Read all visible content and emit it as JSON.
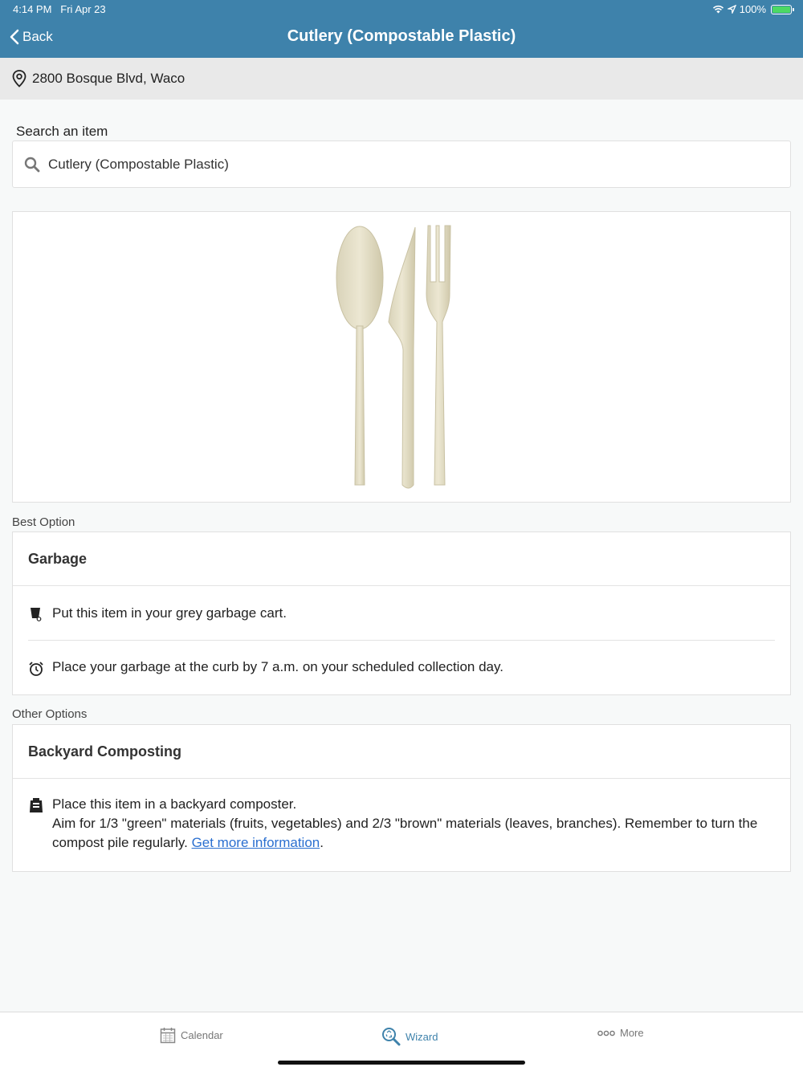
{
  "status_bar": {
    "time": "4:14 PM",
    "date": "Fri Apr 23",
    "battery": "100%",
    "battery_level": 1.0
  },
  "nav": {
    "back_label": "Back",
    "title": "Cutlery (Compostable Plastic)"
  },
  "address": {
    "text": "2800 Bosque Blvd, Waco",
    "icon": "location-pin-icon"
  },
  "search": {
    "label": "Search an item",
    "value": "Cutlery (Compostable Plastic)",
    "icon": "search-icon"
  },
  "best_option": {
    "label": "Best Option",
    "title": "Garbage",
    "rows": [
      {
        "icon": "garbage-cart-icon",
        "text": "Put this item in your grey garbage cart."
      },
      {
        "icon": "alarm-clock-icon",
        "text": "Place your garbage at the curb by 7 a.m. on your scheduled collection day."
      }
    ]
  },
  "other_options": {
    "label": "Other Options",
    "title": "Backyard Composting",
    "line1": "Place this item in a backyard composter.",
    "line2": "Aim for 1/3 \"green\" materials (fruits, vegetables) and 2/3 \"brown\" materials (leaves, branches). Remember to turn the compost pile regularly.",
    "link_text": "Get more information",
    "trailing": ".",
    "icon": "compost-bin-icon"
  },
  "tabs": [
    {
      "label": "Calendar",
      "icon": "calendar-icon",
      "active": false
    },
    {
      "label": "Wizard",
      "icon": "wizard-search-icon",
      "active": true
    },
    {
      "label": "More",
      "icon": "more-dots-icon",
      "active": false
    }
  ],
  "colors": {
    "header": "#3e82ab",
    "link": "#2a6fd0",
    "active_tab": "#3e82ab"
  }
}
